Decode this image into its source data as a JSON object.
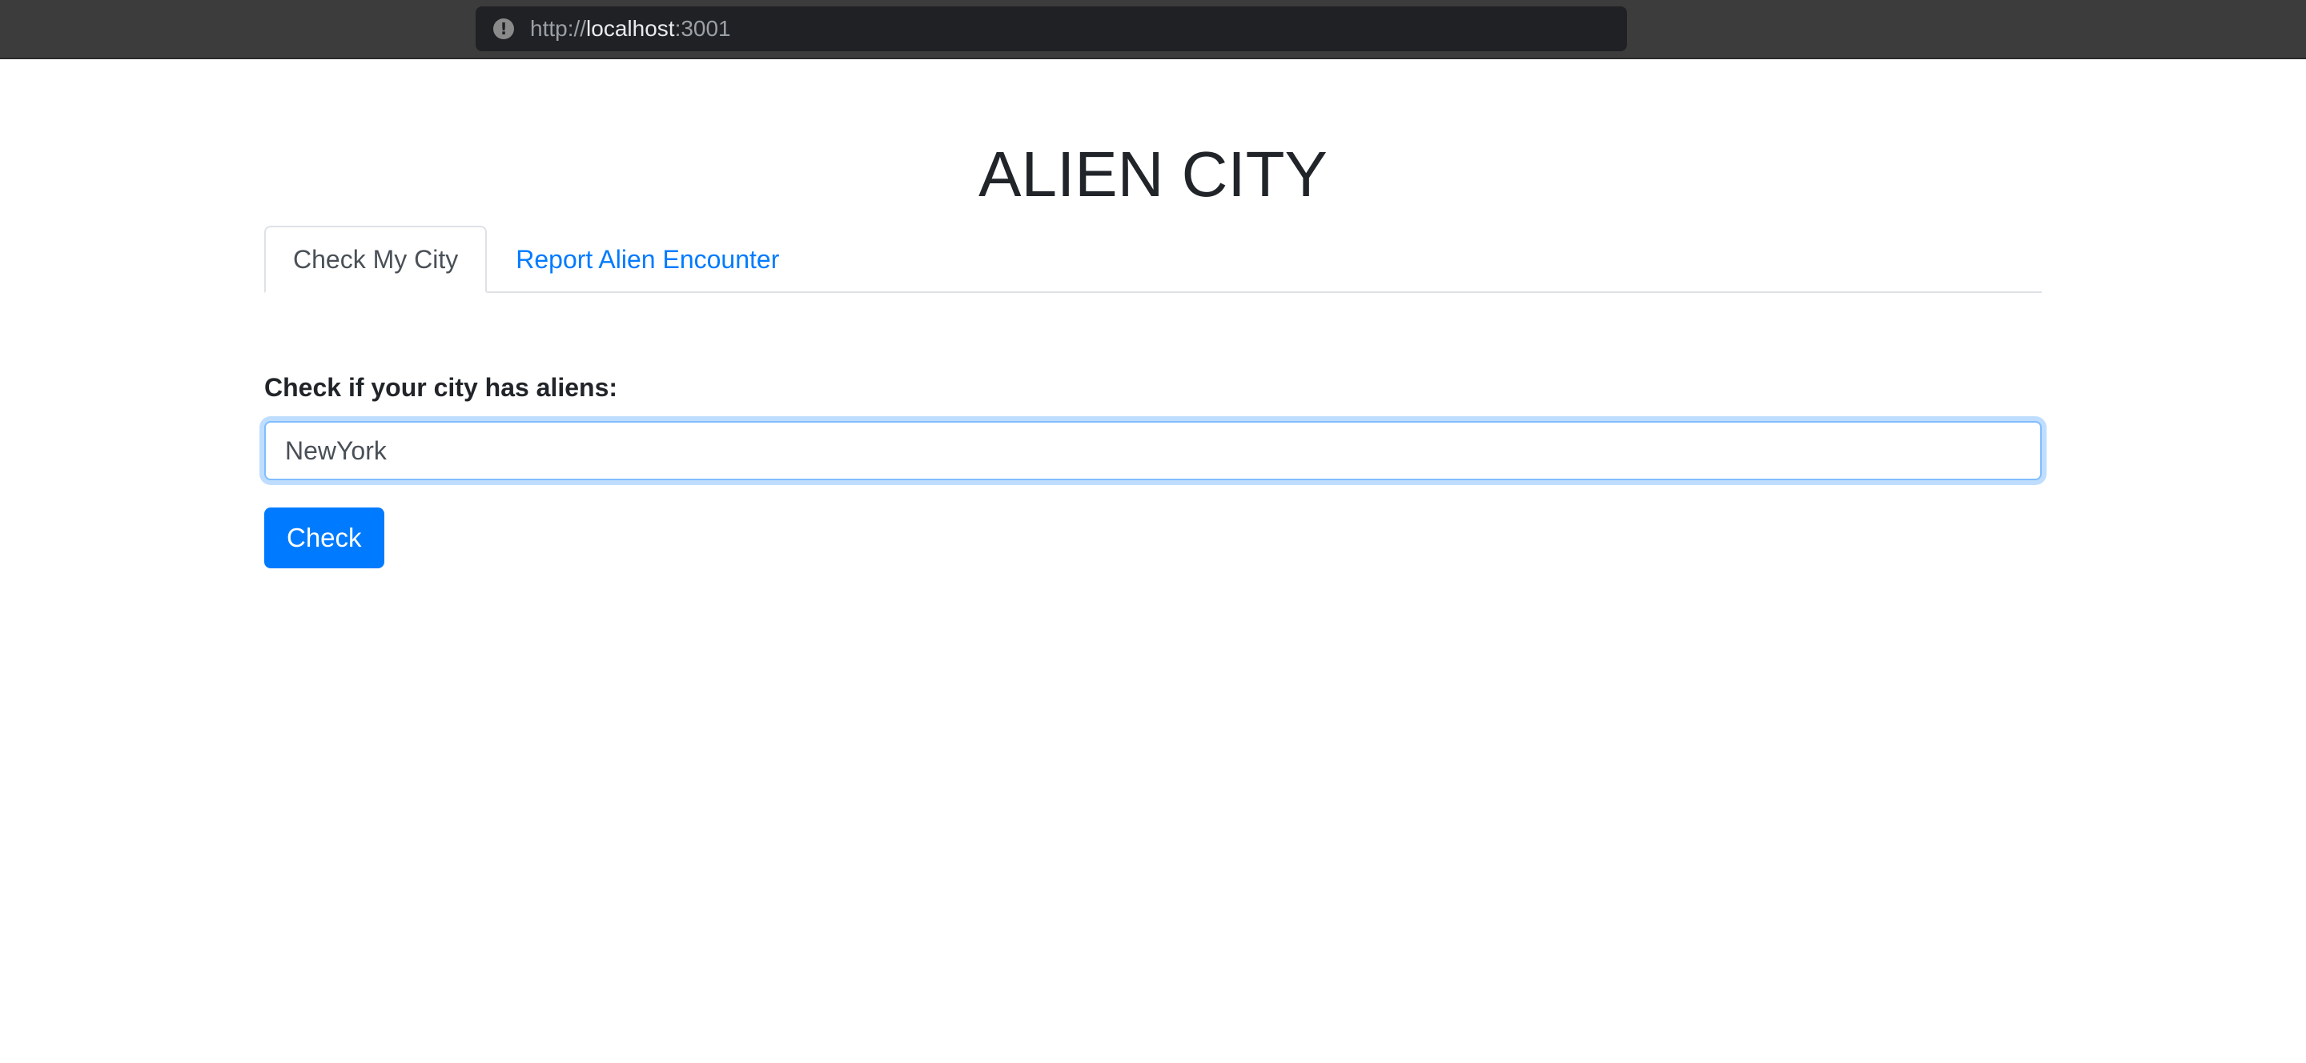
{
  "browser": {
    "url_scheme": "http://",
    "url_host": "localhost",
    "url_port": ":3001",
    "info_icon": "info-icon"
  },
  "page": {
    "title": "ALIEN CITY"
  },
  "tabs": [
    {
      "label": "Check My City",
      "active": true
    },
    {
      "label": "Report Alien Encounter",
      "active": false
    }
  ],
  "form": {
    "label": "Check if your city has aliens:",
    "input_value": "NewYork",
    "button_label": "Check"
  },
  "colors": {
    "primary": "#007bff",
    "text": "#212529",
    "focus_border": "#80bdff"
  }
}
